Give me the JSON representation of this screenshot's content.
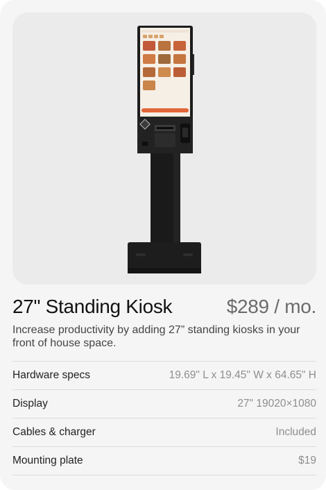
{
  "product": {
    "title": "27\" Standing Kiosk",
    "price": "$289 / mo.",
    "description": "Increase productivity by adding 27” standing kiosks in your front of house space.",
    "image_alt": "Standing kiosk with touchscreen menu"
  },
  "specs": [
    {
      "label": "Hardware specs",
      "value": "19.69\" L x 19.45\" W x 64.65\" H"
    },
    {
      "label": "Display",
      "value": "27\" 19020×1080"
    },
    {
      "label": "Cables & charger",
      "value": "Included"
    },
    {
      "label": "Mounting plate",
      "value": "$19"
    }
  ],
  "colors": {
    "card_bg": "#f5f5f5",
    "image_bg": "#ebebeb",
    "accent": "#e0663a",
    "kiosk_body": "#1c1c1c"
  }
}
